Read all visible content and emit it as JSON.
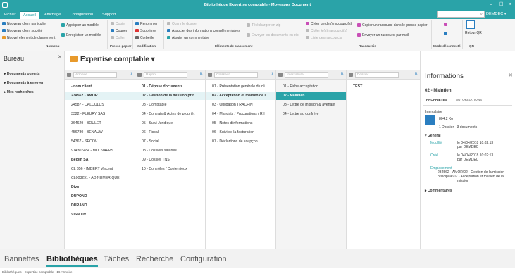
{
  "window": {
    "title": "Bibliothèque Expertise comptable - Moveapps Document"
  },
  "menu": {
    "tabs": [
      "Fichier",
      "Accueil",
      "Affichage",
      "Configuration",
      "Support"
    ],
    "user": "DEMDEC"
  },
  "ribbon": {
    "nouveau": {
      "items": [
        "Nouveau client particulier",
        "Nouveau client société",
        "Nouvel élément de classement"
      ],
      "group": "Nouveau"
    },
    "modele": {
      "items": [
        "Appliquer un modèle",
        "Enregistrer un modèle"
      ]
    },
    "pressepapier": {
      "items": [
        "Copier",
        "Couper",
        "Coller"
      ],
      "group": "Presse-papier"
    },
    "modification": {
      "items": [
        "Renommer",
        "Supprimer",
        "Corbeille"
      ],
      "group": "Modification"
    },
    "classement": {
      "items": [
        "Ouvrir le dossier",
        "Associer des informations complémentaires",
        "Ajouter un commentaire",
        "Télécharger en zip",
        "Envoyer les documents en zip"
      ],
      "group": "Éléments de classement"
    },
    "raccourcis": {
      "items": [
        "Créer un(des) raccourci(s)",
        "Coller le(s) raccourci(s)",
        "Liste des raccourcis",
        "Copier un raccourci dans le presse papier",
        "Envoyer un raccourci par mail"
      ],
      "group": "Raccourcis"
    },
    "deconnecte": {
      "group": "Mode déconnecté"
    },
    "retour": {
      "label": "Retour QR",
      "group": "QR"
    }
  },
  "leftpane": {
    "title": "Bureau",
    "items": [
      "Documents ouverts",
      "Documents à envoyer",
      "Mes recherches"
    ]
  },
  "main": {
    "heading": "Expertise comptable",
    "columns": [
      {
        "placeholder": "Armoire",
        "rows": [
          "- nom client",
          "234562 - AMOR",
          "24587 - CALCULUS",
          "3322 - FLEURY SAS",
          "364629 - BOULET",
          "456780 - BENAUW",
          "54367 - SECOV",
          "974307484 - MOOVAPPS",
          "Belom SA",
          "CL 356 - IMBERT Vincent",
          "CL003291 - AD NUMERIQUE",
          "Divo",
          "DUPOND",
          "DURAND",
          "VISIATIV"
        ]
      },
      {
        "placeholder": "Rayon",
        "rows": [
          "01 - Dépose documents",
          "02 - Gestion de la mission prin...",
          "03 - Comptable",
          "04 - Contrats & Actes de propriét",
          "05 - Suivi Juridique",
          "06 - Fiscal",
          "07 - Social",
          "08 - Dossiers salariés",
          "09 - Dossier TNS",
          "10 - Contrôles / Contentieux"
        ]
      },
      {
        "placeholder": "Classeur",
        "rows": [
          "01 - Présentation générale du cli",
          "02 - Acceptation et maitien de l",
          "03 - Obligation TRACFIN",
          "04 - Mandats / Procurations / RII",
          "05 - Notes d'informations",
          "06 - Suivi de la facturation",
          "07 - Déclartions de soupçon"
        ]
      },
      {
        "placeholder": "Intercalaire",
        "rows": [
          "01 - Fiche acceptation",
          "02 - Maintien",
          "03 - Lettre de mission & avenant",
          "04 - Lettre au confrère"
        ]
      },
      {
        "placeholder": "Dossier",
        "rows": [
          "TEST"
        ]
      }
    ]
  },
  "info": {
    "title": "Informations",
    "subtitle": "02 - Maintien",
    "tabs": [
      "PROPRIETES",
      "AUTORISATIONS"
    ],
    "type_label": "Intercalaire",
    "size": "804,2 Ko",
    "counts": "1 Dossier - 3 documents",
    "general": "Général",
    "modifie_label": "Modifié",
    "modifie_value": "le 04/04/2018 10:02:13",
    "modifie_by": "par DEMDEC",
    "cree_label": "Créé",
    "cree_value": "le 04/04/2018 10:02:13",
    "cree_by": "par DEMDEC",
    "emplacement_label": "Emplacement",
    "emplacement_1": "234562 - AMOR\\02 - Gestion de la mission",
    "emplacement_2": "principale\\02 - Acceptation et maitien de la",
    "emplacement_3": "mission",
    "commentaires": "Commentaires"
  },
  "bottom": {
    "tabs": [
      "Bannettes",
      "Bibliothèques",
      "Tâches",
      "Recherche",
      "Configuration"
    ]
  },
  "status": "Bibliothèques - Expertise comptable - 16 Armoire"
}
